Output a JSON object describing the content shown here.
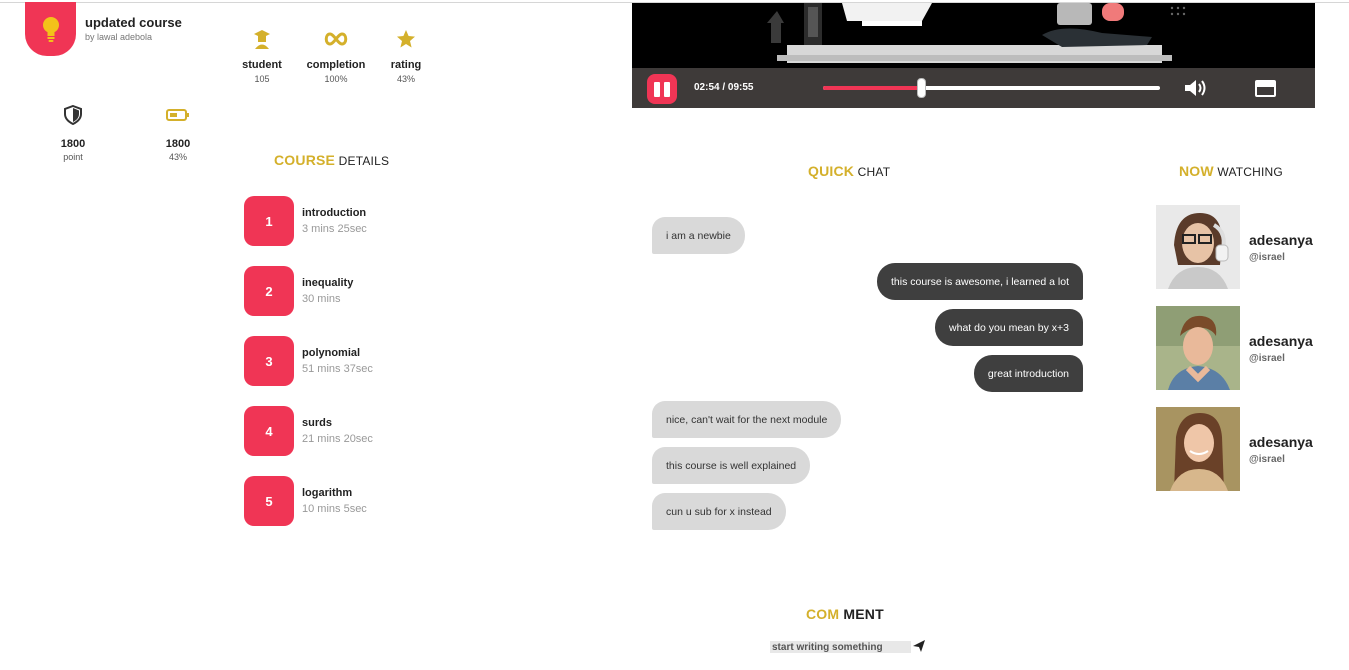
{
  "course": {
    "title": "updated course",
    "author": "by lawal adebola",
    "stats": [
      {
        "label": "student",
        "value": "105",
        "icon": "graduate-icon"
      },
      {
        "label": "completion",
        "value": "100%",
        "icon": "infinity-icon"
      },
      {
        "label": "rating",
        "value": "43%",
        "icon": "star-icon"
      }
    ],
    "points": {
      "value": "1800",
      "label": "point",
      "icon": "shield-icon"
    },
    "battery": {
      "value": "1800",
      "label": "43%",
      "icon": "battery-icon"
    }
  },
  "details": {
    "title_hl": "COURSE",
    "title_rest": " DETAILS",
    "lessons": [
      {
        "num": "1",
        "name": "introduction",
        "duration": "3 mins 25sec"
      },
      {
        "num": "2",
        "name": "inequality",
        "duration": "30 mins"
      },
      {
        "num": "3",
        "name": "polynomial",
        "duration": "51 mins 37sec"
      },
      {
        "num": "4",
        "name": "surds",
        "duration": "21 mins 20sec"
      },
      {
        "num": "5",
        "name": "logarithm",
        "duration": "10 mins 5sec"
      }
    ]
  },
  "video": {
    "time": "02:54 / 09:55",
    "progress": 0.29
  },
  "chat": {
    "title_hl": "QUICK",
    "title_rest": " CHAT",
    "messages": [
      {
        "text": "i am a newbie",
        "dir": "in"
      },
      {
        "text": "this course is awesome, i learned a lot",
        "dir": "out"
      },
      {
        "text": "what do you mean by x+3",
        "dir": "out"
      },
      {
        "text": "great introduction",
        "dir": "out"
      },
      {
        "text": "nice, can't wait for the next module",
        "dir": "in"
      },
      {
        "text": "this course is well explained",
        "dir": "in"
      },
      {
        "text": "cun u sub for x instead",
        "dir": "in"
      }
    ]
  },
  "watching": {
    "title_hl": "NOW",
    "title_rest": " WATCHING",
    "users": [
      {
        "name": "adesanya",
        "handle": "@israel"
      },
      {
        "name": "adesanya",
        "handle": "@israel"
      },
      {
        "name": "adesanya",
        "handle": "@israel"
      }
    ]
  },
  "comment": {
    "title_hl": "COM",
    "title_rest": " MENT",
    "placeholder": "start writing something"
  },
  "colors": {
    "accent": "#f03555",
    "gold": "#d4b02b",
    "dark_bubble": "#3f3f3f",
    "light_bubble": "#d9d9d9"
  }
}
